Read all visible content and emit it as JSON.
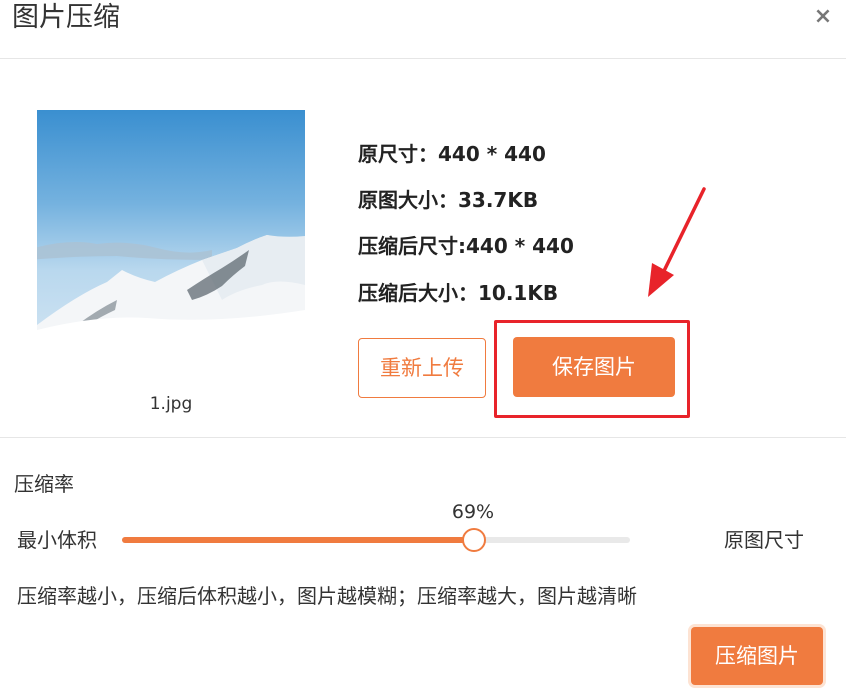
{
  "dialog": {
    "title": "图片压缩",
    "close_symbol": "×"
  },
  "preview": {
    "filename": "1.jpg"
  },
  "info": [
    {
      "label": "原尺寸：",
      "value": "440 * 440"
    },
    {
      "label": "原图大小：",
      "value": "33.7KB"
    },
    {
      "label": "压缩后尺寸:",
      "value": "440 * 440"
    },
    {
      "label": "压缩后大小：",
      "value": "10.1KB"
    }
  ],
  "actions": {
    "reupload_label": "重新上传",
    "save_label": "保存图片"
  },
  "compression": {
    "section_title": "压缩率",
    "min_label": "最小体积",
    "max_label": "原图尺寸",
    "value_label": "69%",
    "value": 0.69,
    "hint": "压缩率越小，压缩后体积越小，图片越模糊；压缩率越大，图片越清晰",
    "button_label": "压缩图片"
  },
  "colors": {
    "accent": "#f07b3f",
    "highlight": "#e8232a"
  },
  "icons": {
    "close": "close-icon",
    "arrow": "annotation-arrow-icon"
  }
}
